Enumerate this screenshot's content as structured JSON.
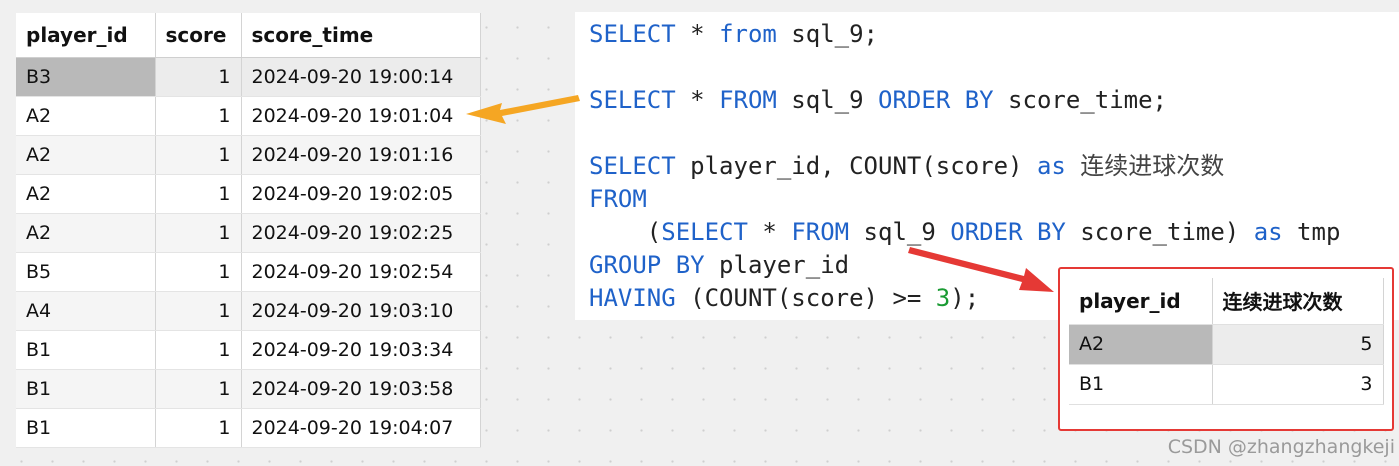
{
  "source_table": {
    "columns": [
      "player_id",
      "score",
      "score_time"
    ],
    "rows": [
      {
        "player_id": "B3",
        "score": "1",
        "score_time": "2024-09-20 19:00:14"
      },
      {
        "player_id": "A2",
        "score": "1",
        "score_time": "2024-09-20 19:01:04"
      },
      {
        "player_id": "A2",
        "score": "1",
        "score_time": "2024-09-20 19:01:16"
      },
      {
        "player_id": "A2",
        "score": "1",
        "score_time": "2024-09-20 19:02:05"
      },
      {
        "player_id": "A2",
        "score": "1",
        "score_time": "2024-09-20 19:02:25"
      },
      {
        "player_id": "B5",
        "score": "1",
        "score_time": "2024-09-20 19:02:54"
      },
      {
        "player_id": "A4",
        "score": "1",
        "score_time": "2024-09-20 19:03:10"
      },
      {
        "player_id": "B1",
        "score": "1",
        "score_time": "2024-09-20 19:03:34"
      },
      {
        "player_id": "B1",
        "score": "1",
        "score_time": "2024-09-20 19:03:58"
      },
      {
        "player_id": "B1",
        "score": "1",
        "score_time": "2024-09-20 19:04:07"
      }
    ]
  },
  "sql": {
    "q1": {
      "kw1": "SELECT",
      "t1": " * ",
      "kw2": "from",
      "t2": " sql_9;"
    },
    "q2": {
      "kw1": "SELECT",
      "t1": " * ",
      "kw2": "FROM",
      "t2": " sql_9 ",
      "kw3": "ORDER BY",
      "t3": " score_time;"
    },
    "q3_line1": {
      "kw1": "SELECT",
      "t1": " player_id, COUNT(score) ",
      "kw2": "as",
      "t2": " ",
      "cn": "连续进球次数"
    },
    "q3_line2": {
      "kw1": "FROM"
    },
    "q3_line3": {
      "t0": "    (",
      "kw1": "SELECT",
      "t1": " * ",
      "kw2": "FROM",
      "t2": " sql_9 ",
      "kw3": "ORDER BY",
      "t3": " score_time) ",
      "kw4": "as",
      "t4": " tmp"
    },
    "q3_line4": {
      "kw1": "GROUP BY",
      "t1": " player_id"
    },
    "q3_line5": {
      "kw1": "HAVING",
      "t1": " (COUNT(score) >= ",
      "num": "3",
      "t2": ");"
    }
  },
  "result_table": {
    "columns": [
      "player_id",
      "连续进球次数"
    ],
    "rows": [
      {
        "player_id": "A2",
        "count": "5"
      },
      {
        "player_id": "B1",
        "count": "3"
      }
    ]
  },
  "colors": {
    "keyword": "#1f62c9",
    "number_literal": "#1a9b33",
    "arrow_to_source": "#f5a623",
    "arrow_to_result": "#e53935",
    "result_border": "#e53935"
  },
  "watermark": "CSDN @zhangzhangkeji"
}
